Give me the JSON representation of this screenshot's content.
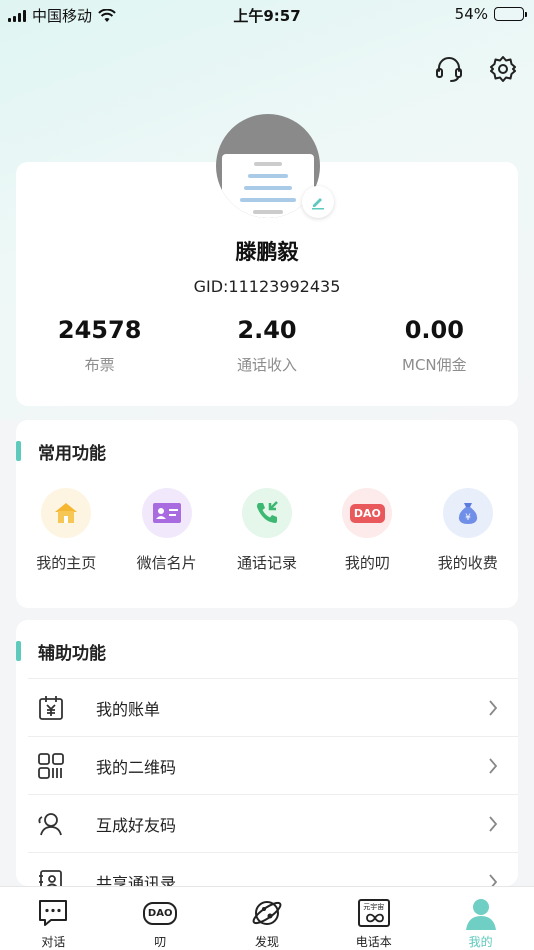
{
  "status_bar": {
    "carrier": "中国移动",
    "time": "上午9:57",
    "battery": "54%",
    "battery_level": 0.54
  },
  "profile": {
    "name": "滕鹏毅",
    "gid": "GID:11123992435",
    "stats": [
      {
        "value": "24578",
        "label": "布票"
      },
      {
        "value": "2.40",
        "label": "通话收入"
      },
      {
        "value": "0.00",
        "label": "MCN佣金"
      }
    ]
  },
  "common": {
    "title": "常用功能",
    "items": [
      {
        "label": "我的主页",
        "icon": "home-icon"
      },
      {
        "label": "微信名片",
        "icon": "card-icon"
      },
      {
        "label": "通话记录",
        "icon": "call-log-icon"
      },
      {
        "label": "我的叨",
        "icon": "dao-icon",
        "icon_text": "DAO"
      },
      {
        "label": "我的收费",
        "icon": "money-bag-icon",
        "icon_text": "¥"
      }
    ]
  },
  "aux": {
    "title": "辅助功能",
    "items": [
      {
        "label": "我的账单",
        "icon": "bill-icon",
        "icon_text": "¥"
      },
      {
        "label": "我的二维码",
        "icon": "qr-icon"
      },
      {
        "label": "互成好友码",
        "icon": "friend-code-icon"
      },
      {
        "label": "共享通讯录",
        "icon": "contacts-icon"
      }
    ]
  },
  "tabs": [
    {
      "label": "对话",
      "icon": "chat-icon"
    },
    {
      "label": "叨",
      "icon": "dao-tab-icon",
      "icon_text": "DAO"
    },
    {
      "label": "发现",
      "icon": "planet-icon"
    },
    {
      "label": "电话本",
      "icon": "phonebook-icon",
      "icon_text": "元宇宙"
    },
    {
      "label": "我的",
      "icon": "profile-icon",
      "active": true
    }
  ],
  "colors": {
    "accent": "#5ec9bd"
  }
}
